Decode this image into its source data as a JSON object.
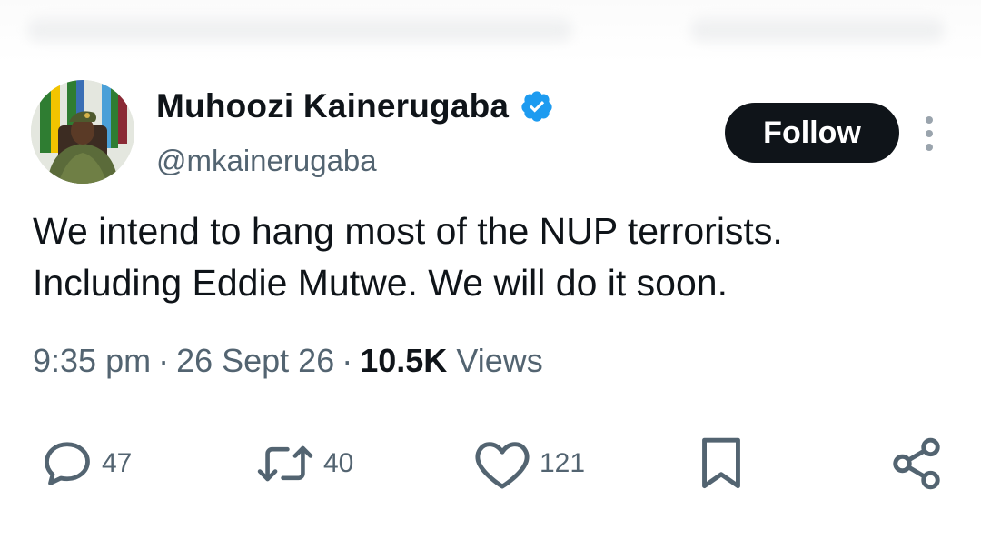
{
  "author": {
    "name": "Muhoozi Kainerugaba",
    "handle": "@mkainerugaba",
    "verified_color": "#1d9bf0"
  },
  "header": {
    "follow_label": "Follow",
    "more_icon": "vertical-ellipsis-icon"
  },
  "tweet": {
    "lines": [
      "We intend to hang most of the NUP terrorists.",
      "Including Eddie Mutwe. We will do it soon."
    ]
  },
  "meta": {
    "time": "9:35 pm",
    "date": "26 Sept 26",
    "views_count": "10.5K",
    "views_label": "Views"
  },
  "actions": {
    "reply": {
      "icon": "reply-icon",
      "count": "47"
    },
    "retweet": {
      "icon": "retweet-icon",
      "count": "40"
    },
    "like": {
      "icon": "heart-icon",
      "count": "121"
    },
    "bookmark": {
      "icon": "bookmark-icon"
    },
    "share": {
      "icon": "share-icon"
    }
  },
  "colors": {
    "text": "#0f1419",
    "secondary": "#536471",
    "button": "#0f1419"
  }
}
